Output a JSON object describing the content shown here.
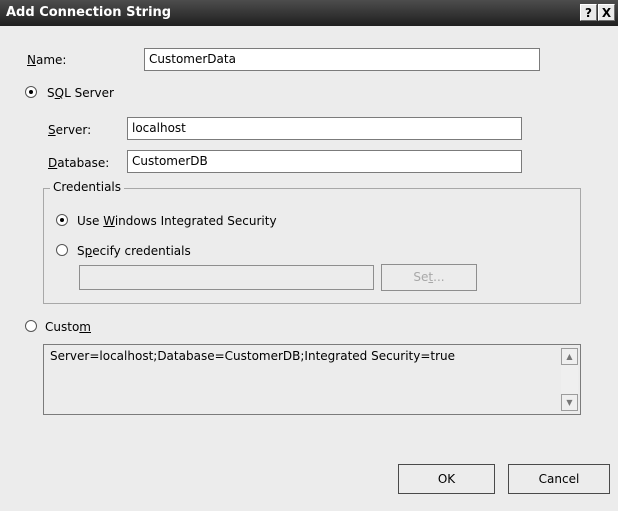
{
  "window": {
    "title": "Add Connection String",
    "help_label": "?",
    "close_label": "X"
  },
  "name": {
    "label_underlined": "N",
    "label_rest": "ame:",
    "value": "CustomerData"
  },
  "sql_server": {
    "label_pre": "S",
    "label_underlined": "Q",
    "label_post": "L Server",
    "selected": true
  },
  "server": {
    "label_underlined": "S",
    "label_rest": "erver:",
    "value": "localhost"
  },
  "database": {
    "label_underlined": "D",
    "label_rest": "atabase:",
    "value": "CustomerDB"
  },
  "credentials": {
    "legend": "Credentials",
    "windows_pre": "Use ",
    "windows_underlined": "W",
    "windows_post": "indows Integrated Security",
    "windows_selected": true,
    "specify_pre": "S",
    "specify_underlined": "p",
    "specify_post": "ecify credentials",
    "specify_selected": false,
    "set_pre": "Se",
    "set_underlined": "t",
    "set_post": "..."
  },
  "custom": {
    "label_pre": "Custo",
    "label_underlined": "m",
    "selected": false,
    "value": "Server=localhost;Database=CustomerDB;Integrated Security=true"
  },
  "buttons": {
    "ok": "OK",
    "cancel": "Cancel"
  }
}
